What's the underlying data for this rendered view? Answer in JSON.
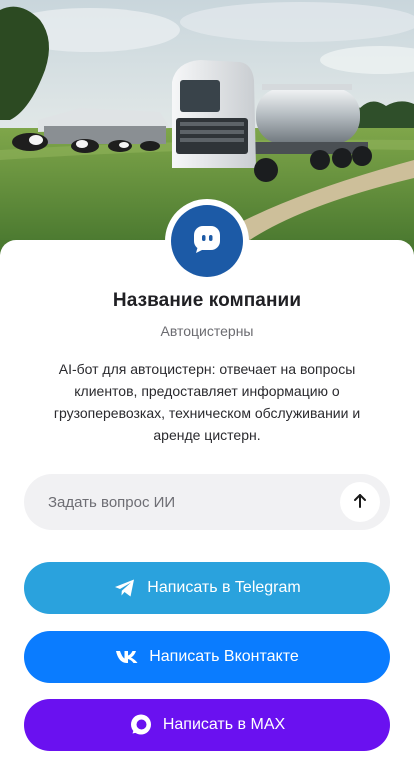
{
  "hero": {
    "illustration": "truck-tanker-farm-photo"
  },
  "company": {
    "avatar_icon": "chat-bot-icon",
    "name": "Название компании",
    "category": "Автоцистерны",
    "description": "AI-бот для автоцистерн: отвечает на вопросы клиентов, предоставляет информацию о грузоперевозках, техническом обслуживании и аренде цистерн."
  },
  "ask": {
    "placeholder": "Задать вопрос ИИ",
    "value": "",
    "send_icon": "arrow-up-icon"
  },
  "actions": [
    {
      "label": "Написать в Telegram",
      "icon": "telegram-icon",
      "color": "#2aa2dd"
    },
    {
      "label": "Написать Вконтакте",
      "icon": "vk-icon",
      "color": "#0a7cff"
    },
    {
      "label": "Написать в MAX",
      "icon": "max-icon",
      "color": "#6a11f0"
    }
  ],
  "colors": {
    "avatar_bg": "#1c5aa6",
    "text_primary": "#202024",
    "text_secondary": "#6b6b70",
    "field_bg": "#f1f1f3"
  }
}
